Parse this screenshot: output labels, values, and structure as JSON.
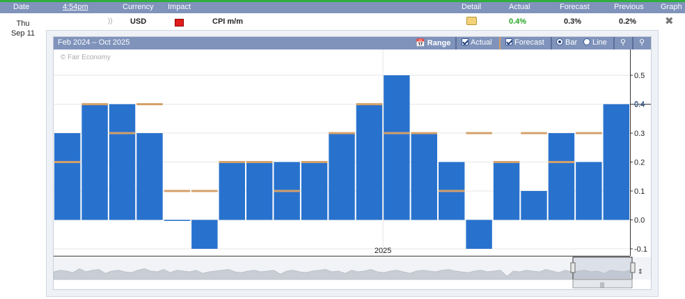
{
  "header": {
    "date": "Date",
    "time": "4:54pm",
    "currency": "Currency",
    "impact": "Impact",
    "detail": "Detail",
    "actual": "Actual",
    "forecast": "Forecast",
    "previous": "Previous",
    "graph": "Graph"
  },
  "event": {
    "day": "Thu",
    "date": "Sep 11",
    "currency": "USD",
    "name": "CPI m/m",
    "actual": "0.4%",
    "forecast": "0.3%",
    "previous": "0.2%",
    "impact_color": "#e01b1b"
  },
  "toolbar": {
    "range_label": "Feb 2024 – Oct 2025",
    "range_button": "Range",
    "actual_toggle": "Actual",
    "forecast_toggle": "Forecast",
    "bar_option": "Bar",
    "line_option": "Line",
    "icons": [
      "calendar-icon",
      "zoom-in-icon",
      "zoom-out-icon"
    ]
  },
  "attribution": "© Fair Economy",
  "colors": {
    "bar": "#2872ce",
    "forecast_marker": "#d4a06a",
    "header_bg": "#7f93bb",
    "actual_text": "#23a323",
    "current_value_label": "#3a6fb0"
  },
  "chart_data": {
    "type": "bar",
    "series": [
      {
        "name": "Actual",
        "values": [
          0.3,
          0.4,
          0.4,
          0.3,
          0.0,
          -0.1,
          0.2,
          0.2,
          0.2,
          0.2,
          0.3,
          0.4,
          0.5,
          0.3,
          0.2,
          -0.1,
          0.2,
          0.1,
          0.3,
          0.2,
          0.4
        ]
      },
      {
        "name": "Forecast",
        "values": [
          0.2,
          0.4,
          0.3,
          0.4,
          0.1,
          0.1,
          0.2,
          0.2,
          0.1,
          0.2,
          0.3,
          0.4,
          0.3,
          0.3,
          0.1,
          0.3,
          0.2,
          0.3,
          0.2,
          0.3
        ]
      }
    ],
    "x_labels": [
      {
        "index": 11.5,
        "label": "2025"
      }
    ],
    "y_ticks": [
      -0.1,
      0.0,
      0.1,
      0.2,
      0.3,
      0.4,
      0.5
    ],
    "y_tick_labels": [
      "-0.1",
      "0.0",
      "0.1",
      "0.2",
      "0.3",
      "0.4",
      "0.5"
    ],
    "ylim": [
      -0.1,
      0.5
    ],
    "current_value_label": "0.4",
    "grid": true,
    "navigator_series": [
      0.5,
      0.6,
      0.55,
      0.45,
      0.7,
      0.5,
      0.6,
      0.65,
      0.4,
      0.55,
      0.6,
      0.5,
      0.45,
      0.6,
      0.7,
      0.55,
      0.5,
      0.65,
      0.45,
      0.6,
      0.55,
      0.5,
      0.6,
      0.4,
      0.5,
      0.55,
      0.6,
      0.65,
      0.5,
      0.45,
      0.55,
      0.6,
      0.5,
      0.55,
      0.6,
      0.35,
      0.55,
      0.6,
      0.5,
      0.45,
      0.55,
      0.6,
      0.65,
      0.5,
      0.55,
      0.4,
      0.6,
      0.5,
      0.55,
      0.65,
      0.5,
      0.45,
      0.55,
      0.6,
      0.5,
      0.4,
      0.55,
      0.6,
      0.55,
      0.5,
      0.6,
      0.65,
      0.55,
      0.5,
      0.45,
      0.55,
      0.6,
      0.5,
      0.55,
      0.6,
      0.2,
      0.55,
      0.5,
      0.6,
      0.55,
      0.5,
      0.65,
      0.55,
      0.45,
      0.6,
      0.5,
      0.55,
      0.6,
      0.5,
      0.55,
      0.4,
      0.6,
      0.55,
      0.5,
      0.6
    ]
  }
}
